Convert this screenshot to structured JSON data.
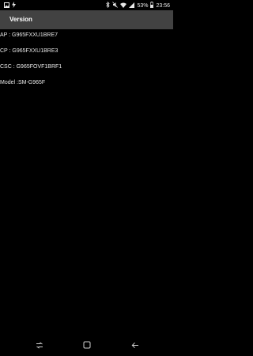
{
  "status_bar": {
    "battery": "53%",
    "time": "23:56"
  },
  "app_bar": {
    "title": "Version"
  },
  "info_lines": {
    "ap": "AP : G965FXXU1BRE7",
    "cp": "CP : G965FXXU1BRE3",
    "csc": "CSC : G965FOVF1BRF1",
    "model": "Model :SM-G965F"
  },
  "icons": {
    "status_left": [
      "gallery-icon",
      "lightning-icon"
    ],
    "status_right": [
      "bluetooth-icon",
      "mute-icon",
      "wifi-icon",
      "signal-icon",
      "battery-icon"
    ],
    "nav": [
      "recent-apps-icon",
      "home-icon",
      "back-icon"
    ]
  }
}
